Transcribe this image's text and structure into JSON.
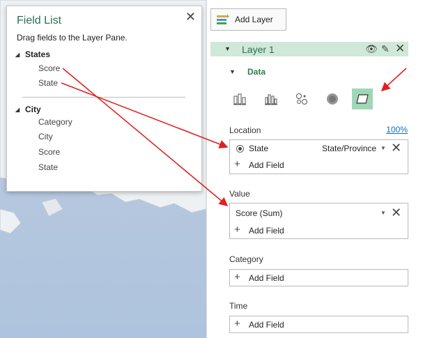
{
  "field_list": {
    "title": "Field List",
    "subtitle": "Drag fields to the Layer Pane.",
    "groups": [
      {
        "name": "States",
        "items": [
          "Score",
          "State"
        ]
      },
      {
        "name": "City",
        "items": [
          "Category",
          "City",
          "Score",
          "State"
        ]
      }
    ]
  },
  "pane": {
    "add_layer_label": "Add Layer",
    "layer_name": "Layer 1",
    "data_label": "Data",
    "location": {
      "label": "Location",
      "zoom": "100%",
      "field": "State",
      "field_type": "State/Province",
      "add_field": "Add Field"
    },
    "value": {
      "label": "Value",
      "field": "Score (Sum)",
      "add_field": "Add Field"
    },
    "category": {
      "label": "Category",
      "add_field": "Add Field"
    },
    "time": {
      "label": "Time",
      "add_field": "Add Field"
    }
  },
  "colors": {
    "accent_green": "#2e6e52",
    "layer_bar": "#cfe8d8",
    "selected_viz": "#9fd7b8",
    "annotation_arrow": "#e02020"
  },
  "icons": {
    "viz_types": [
      "stacked-column-icon",
      "clustered-column-icon",
      "bubble-icon",
      "heat-map-icon",
      "region-icon"
    ]
  }
}
